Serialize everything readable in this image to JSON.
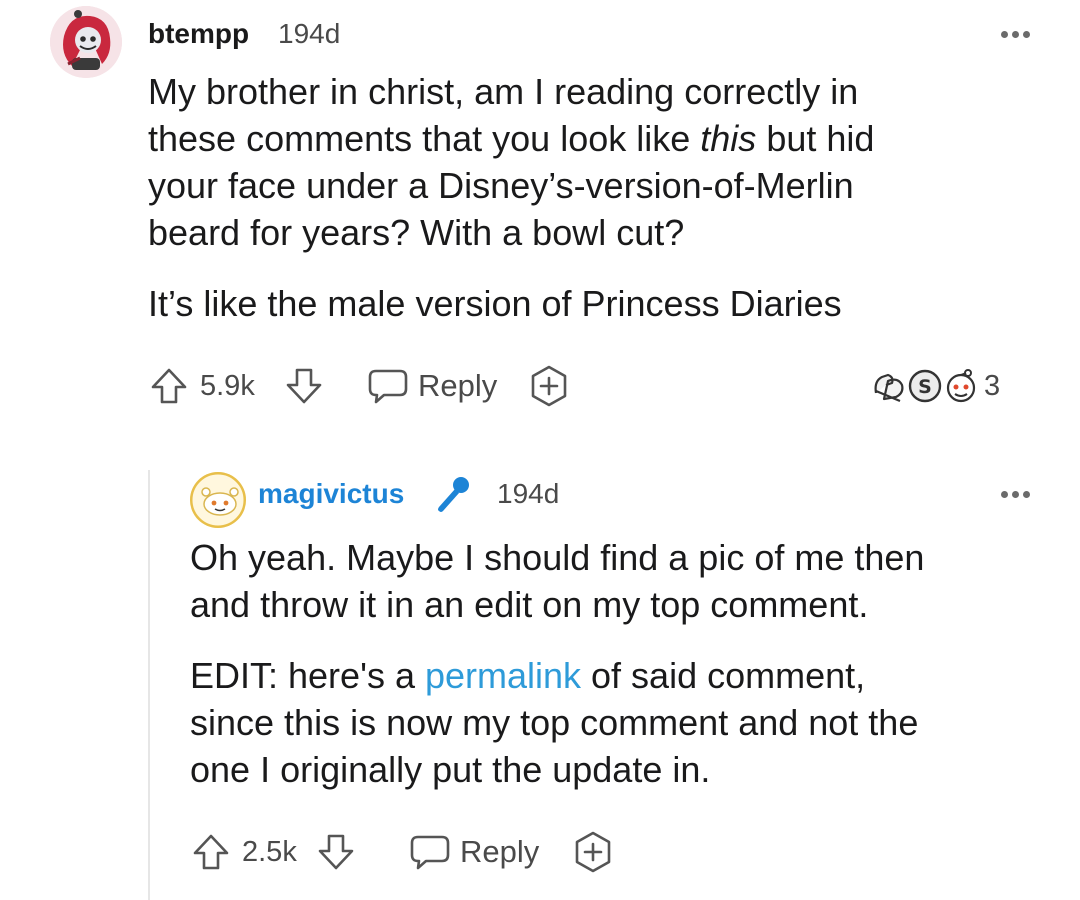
{
  "comments": [
    {
      "username": "btempp",
      "age": "194d",
      "body_line1": "My brother in christ, am I reading correctly in",
      "body_line2_pre": "these comments that you look like ",
      "body_line2_em": "this",
      "body_line2_post": " but hid",
      "body_line3": "your face under a Disney’s-version-of-Merlin",
      "body_line4": "beard for years? With a bowl cut?",
      "body_p2": "It’s like the male version of Princess Diaries",
      "votes": "5.9k",
      "reply_label": "Reply",
      "awards_count": "3",
      "colors": {
        "avatar_main": "#c9283e",
        "avatar_bg": "#f6d6dc"
      }
    },
    {
      "username": "magivictus",
      "age": "194d",
      "body_line1": "Oh yeah. Maybe I should find a pic of me then",
      "body_line2": "and throw it in an edit on my top comment.",
      "edit_pre": "EDIT: here's a ",
      "edit_link": "permalink",
      "edit_post": " of said comment,",
      "edit_line2": "since this is now my top comment and not the",
      "edit_line3": "one I originally put the update in.",
      "votes": "2.5k",
      "reply_label": "Reply",
      "badge_icon": "microphone-icon",
      "colors": {
        "username": "#1d84d6",
        "badge": "#1d84d6",
        "link": "#2e9bd9",
        "avatar_ring": "#f1c85a"
      }
    }
  ]
}
